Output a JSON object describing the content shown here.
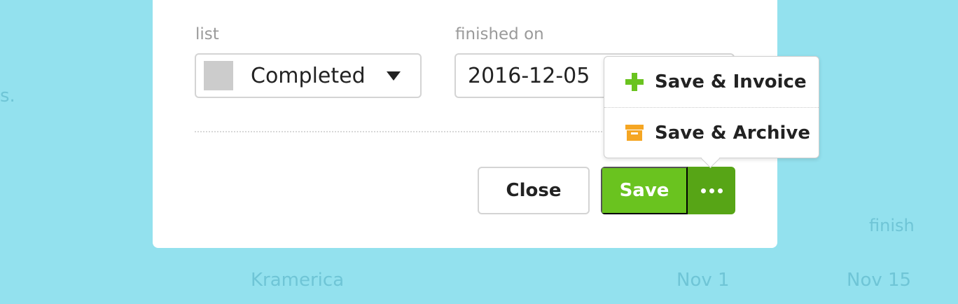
{
  "background": {
    "partial_text": "s.",
    "column_label": "finish",
    "row": {
      "client": "Kramerica",
      "date_1": "Nov 1",
      "date_2": "Nov 15"
    }
  },
  "form": {
    "list_label": "list",
    "list_value": "Completed",
    "list_swatch_color": "#cccccc",
    "finished_label": "finished on",
    "finished_value": "2016-12-05"
  },
  "actions": {
    "close_label": "Close",
    "save_label": "Save",
    "more_icon": "ellipsis-icon"
  },
  "save_menu": {
    "items": [
      {
        "label": "Save & Invoice",
        "icon": "plus-icon",
        "color": "#6ac31f"
      },
      {
        "label": "Save & Archive",
        "icon": "archive-box-icon",
        "color": "#f5a623"
      }
    ]
  },
  "colors": {
    "page_background": "#93e1ee",
    "save_green": "#6ac31f",
    "save_green_dark": "#57a516"
  }
}
